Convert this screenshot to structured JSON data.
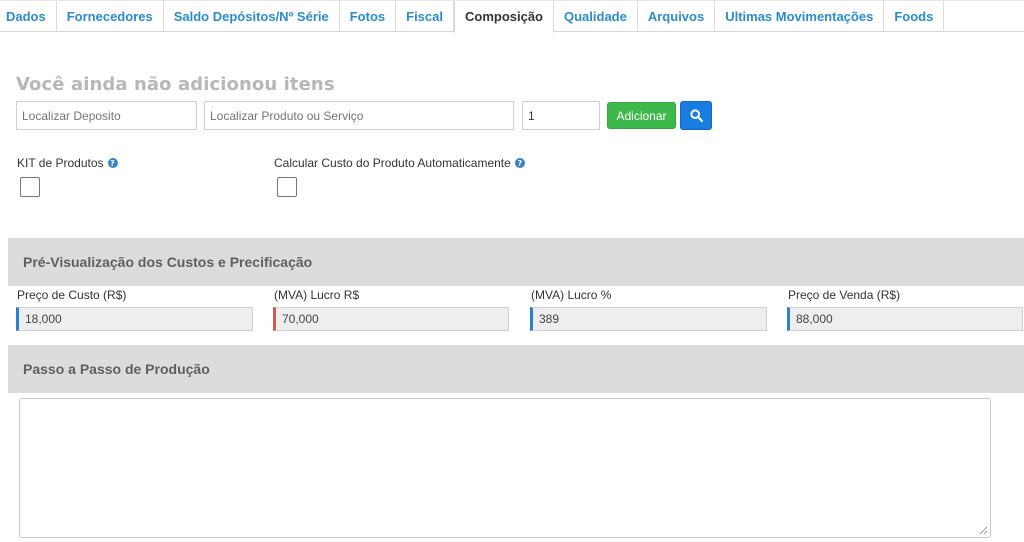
{
  "tabs": [
    {
      "label": "Dados",
      "active": false
    },
    {
      "label": "Fornecedores",
      "active": false
    },
    {
      "label": "Saldo Depósitos/Nº Série",
      "active": false
    },
    {
      "label": "Fotos",
      "active": false
    },
    {
      "label": "Fiscal",
      "active": false
    },
    {
      "label": "Composição",
      "active": true
    },
    {
      "label": "Qualidade",
      "active": false
    },
    {
      "label": "Arquivos",
      "active": false
    },
    {
      "label": "Ultimas Movimentações",
      "active": false
    },
    {
      "label": "Foods",
      "active": false
    }
  ],
  "composition": {
    "empty_title": "Você ainda não adicionou itens",
    "deposit_placeholder": "Localizar Deposito",
    "product_placeholder": "Localizar Produto ou Serviço",
    "quantity_value": "1",
    "add_label": "Adicionar",
    "search_icon": "search-icon"
  },
  "options": {
    "kit_label": "KIT de Produtos",
    "auto_cost_label": "Calcular Custo do Produto Automaticamente",
    "help_icon": "question-icon"
  },
  "preview": {
    "title": "Pré-Visualização dos Custos e Precificação",
    "cost_label": "Preço de Custo (R$)",
    "cost_value": "18,000",
    "mva_profit_label": "(MVA) Lucro R$",
    "mva_profit_value": "70,000",
    "mva_percent_label": "(MVA) Lucro %",
    "mva_percent_value": "389",
    "sale_price_label": "Preço de Venda (R$)",
    "sale_price_value": "88,000"
  },
  "production": {
    "title": "Passo a Passo de Produção"
  },
  "colors": {
    "tab_link": "#2a8ccf",
    "add_button": "#3db84a",
    "search_button": "#1a7be0",
    "section_bg": "#dcdcdc",
    "accent_blue": "#2a7fd6",
    "accent_red": "#d9534f"
  }
}
